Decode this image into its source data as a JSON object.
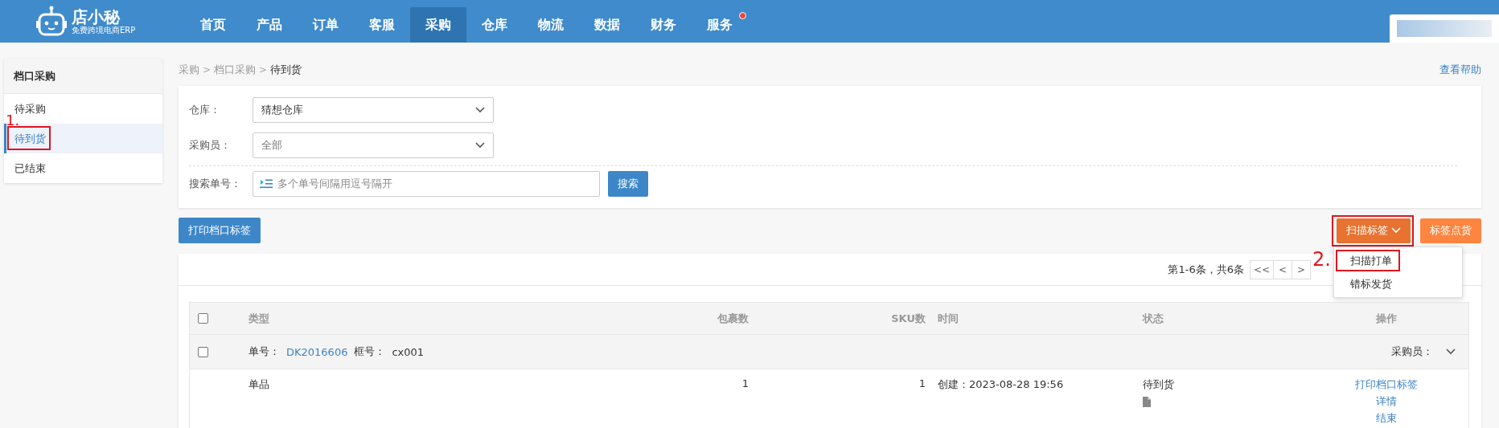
{
  "app": {
    "logo_name": "店小秘",
    "logo_tagline": "免费跨境电商ERP"
  },
  "nav": [
    {
      "label": "首页",
      "selected": false,
      "badge": false
    },
    {
      "label": "产品",
      "selected": false,
      "badge": false
    },
    {
      "label": "订单",
      "selected": false,
      "badge": false
    },
    {
      "label": "客服",
      "selected": false,
      "badge": false
    },
    {
      "label": "采购",
      "selected": true,
      "badge": false
    },
    {
      "label": "仓库",
      "selected": false,
      "badge": false
    },
    {
      "label": "物流",
      "selected": false,
      "badge": false
    },
    {
      "label": "数据",
      "selected": false,
      "badge": false
    },
    {
      "label": "财务",
      "selected": false,
      "badge": false
    },
    {
      "label": "服务",
      "selected": false,
      "badge": true
    }
  ],
  "sidebar": {
    "title": "档口采购",
    "items": [
      {
        "label": "待采购",
        "selected": false
      },
      {
        "label": "待到货",
        "selected": true,
        "annotation": "1."
      },
      {
        "label": "已结束",
        "selected": false
      }
    ]
  },
  "breadcrumb": {
    "items": [
      "采购",
      "档口采购",
      "待到货"
    ],
    "separator": ">"
  },
  "help_link": "查看帮助",
  "filters": [
    {
      "kind": "select",
      "label": "仓库：",
      "value": "猜想仓库"
    },
    {
      "kind": "select",
      "label": "采购员：",
      "value": "全部"
    },
    {
      "kind": "search",
      "label": "搜索单号：",
      "placeholder": "多个单号间隔用逗号隔开",
      "button": "搜索"
    }
  ],
  "actions": {
    "print_button": "打印档口标签",
    "scan_button": {
      "label": "扫描标签",
      "framed": true
    },
    "count_button": "标签点货"
  },
  "scan_menu": {
    "expanded": true,
    "items": [
      {
        "label": "扫描打单",
        "annotation": "2."
      },
      {
        "label": "错标发货"
      }
    ]
  },
  "pagination": {
    "summary": "第1-6条，共6条",
    "buttons": [
      "<<",
      "<",
      ">"
    ]
  },
  "table": {
    "select_all_checked": false,
    "columns": [
      "类型",
      "包裹数",
      "SKU数",
      "时间",
      "状态",
      "操作"
    ],
    "groups": [
      {
        "checked": false,
        "order_label": "单号：",
        "order_no": "DK2016606",
        "box_label": "框号：",
        "box_no": "cx001",
        "buyer_label": "采购员：",
        "rows": [
          {
            "type": "单品",
            "packages": "1",
            "skus": "1",
            "time": "创建：2023-08-28 19:56",
            "status": "待到货",
            "actions": [
              "打印档口标签",
              "详情",
              "结束"
            ]
          }
        ]
      }
    ]
  }
}
